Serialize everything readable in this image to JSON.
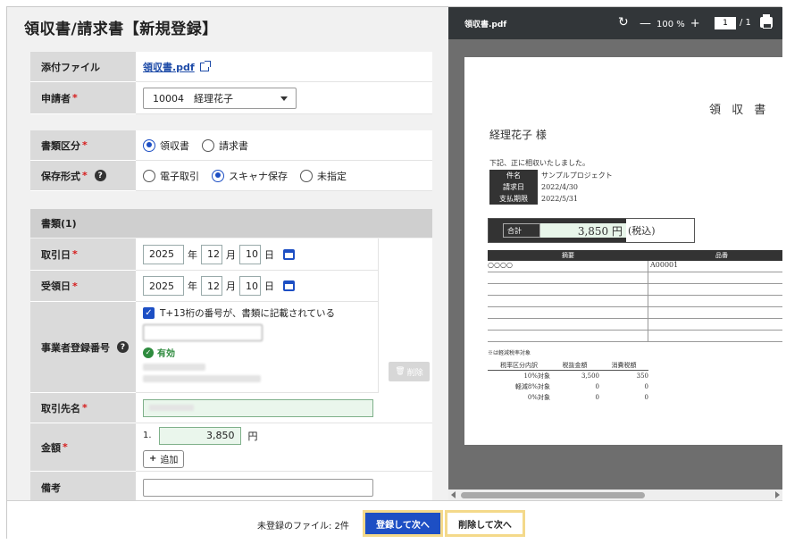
{
  "title": "領収書/請求書【新規登録】",
  "fields": {
    "attachment_label": "添付ファイル",
    "attachment_file": "領収書.pdf",
    "applicant_label": "申請者",
    "applicant_value": "10004　経理花子",
    "doc_type_label": "書類区分",
    "doc_type_options": [
      "領収書",
      "請求書"
    ],
    "doc_type_selected": "領収書",
    "storage_label": "保存形式",
    "storage_options": [
      "電子取引",
      "スキャナ保存",
      "未指定"
    ],
    "storage_selected": "スキャナ保存",
    "required_mark": "*",
    "help_icon": "?"
  },
  "section": {
    "title": "書類(1)",
    "transaction_date_label": "取引日",
    "transaction_date": {
      "year": "2025",
      "month": "12",
      "day": "10"
    },
    "receipt_date_label": "受領日",
    "receipt_date": {
      "year": "2025",
      "month": "12",
      "day": "10"
    },
    "date_units": {
      "year": "年",
      "month": "月",
      "day": "日"
    },
    "business_reg_label": "事業者登録番号",
    "business_reg_check": "T+13桁の番号が、書類に記載されている",
    "valid_text": "有効",
    "partner_label": "取引先名",
    "amount_label": "金額",
    "amount_index": "1.",
    "amount_value": "3,850",
    "amount_unit": "円",
    "add_button": "追加",
    "delete_button": "削除",
    "notes_label": "備考"
  },
  "pdf": {
    "filename": "領収書.pdf",
    "zoom": "100 %",
    "page": "1",
    "page_total": "/ 1",
    "doc_title": "領 収 書",
    "recipient": "経理花子 様",
    "intro": "下記、正に相収いたしました。",
    "info": [
      {
        "k": "件名",
        "v": "サンプルプロジェクト"
      },
      {
        "k": "請求日",
        "v": "2022/4/30"
      },
      {
        "k": "支払期限",
        "v": "2022/5/31"
      }
    ],
    "total_label": "合計",
    "total_value": "3,850 円",
    "total_note": "(税込)",
    "table_headers": [
      "摘要",
      "品番"
    ],
    "table_first_row": [
      "○○○○",
      "A00001"
    ],
    "tax_note": "※は軽減税率対象",
    "tax_headers": [
      "税率区分内訳",
      "税抜金額",
      "消費税額"
    ],
    "tax_rows": [
      [
        "10%対象",
        "3,500",
        "350"
      ],
      [
        "軽減8%対象",
        "0",
        "0"
      ],
      [
        "0%対象",
        "0",
        "0"
      ]
    ]
  },
  "footer": {
    "unregistered": "未登録のファイル: 2件",
    "register_next": "登録して次へ",
    "delete_next": "削除して次へ"
  }
}
